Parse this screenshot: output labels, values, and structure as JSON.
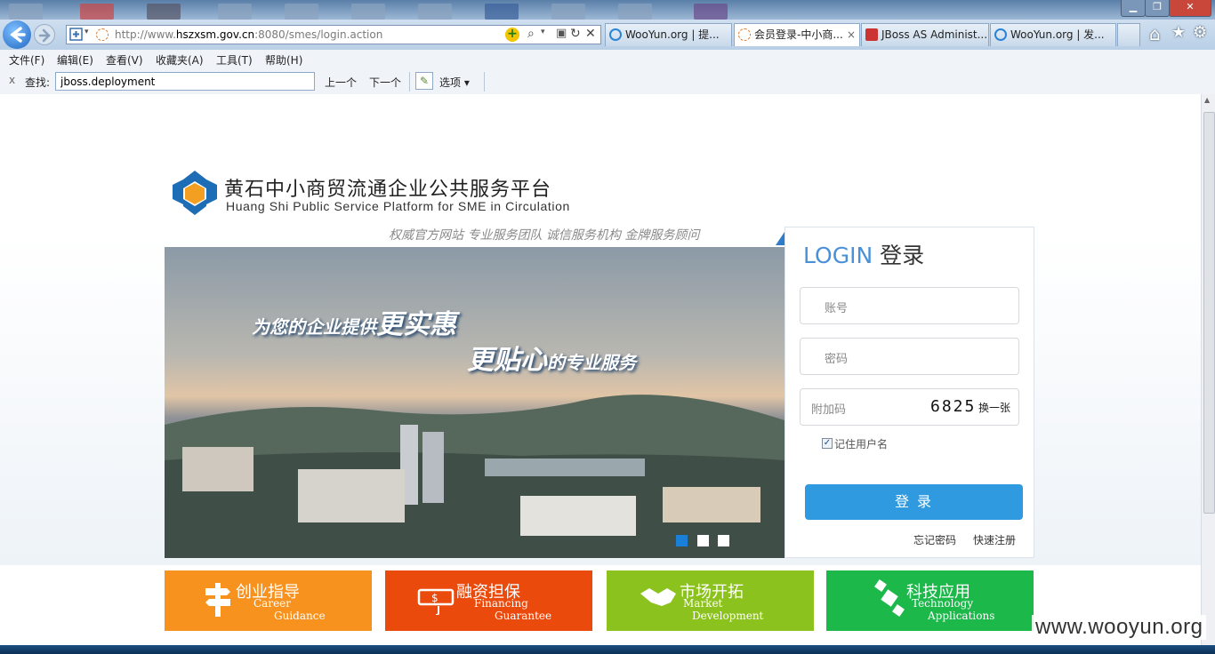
{
  "browser": {
    "address_url_prefix": "http://www.",
    "address_url_host": "hszxsm.gov.cn",
    "address_url_rest": ":8080/smes/login.action",
    "tabs": [
      {
        "label": "WooYun.org | 提..."
      },
      {
        "label": "会员登录-中小商..."
      },
      {
        "label": "JBoss AS Administ..."
      },
      {
        "label": "WooYun.org | 发..."
      }
    ],
    "tab_close": "×",
    "window_buttons": {
      "minimize": "▁",
      "restore": "❐",
      "close": "✕"
    },
    "toolbar_icons": {
      "home": "⌂",
      "favorites": "★",
      "tools": "⚙"
    }
  },
  "menu": [
    "文件(F)",
    "编辑(E)",
    "查看(V)",
    "收藏夹(A)",
    "工具(T)",
    "帮助(H)"
  ],
  "findbar": {
    "close": "x",
    "label": "查找:",
    "value": "jboss.deployment",
    "prev": "上一个",
    "next": "下一个",
    "options": "选项"
  },
  "site": {
    "title_cn": "黄石中小商贸流通企业公共服务平台",
    "title_en": "Huang Shi Public Service Platform for SME in Circulation",
    "slogan": "权威官方网站 专业服务团队  诚信服务机构  金牌服务顾问",
    "banner_line1_a": "为您的企业提供",
    "banner_line1_b": "更实惠",
    "banner_line2_a": "更贴心",
    "banner_line2_b": "的专业服务"
  },
  "login": {
    "title_en": "LOGIN",
    "title_cn": "登录",
    "account_placeholder": "账号",
    "password_placeholder": "密码",
    "captcha_placeholder": "附加码",
    "captcha_code": "6825",
    "captcha_refresh": "换一张",
    "remember_label": "记住用户名",
    "remember_checked": true,
    "submit": "登 录",
    "forgot": "忘记密码",
    "register": "快速注册"
  },
  "tiles": [
    {
      "cn": "创业指导",
      "en1": "Career",
      "en2": "Guidance",
      "color": "#f7921e"
    },
    {
      "cn": "融资担保",
      "en1": "Financing",
      "en2": "Guarantee",
      "color": "#ea4a0c"
    },
    {
      "cn": "市场开拓",
      "en1": "Market",
      "en2": "Development",
      "color": "#8cc21e"
    },
    {
      "cn": "科技应用",
      "en1": "Technology",
      "en2": "Applications",
      "color": "#1cb84a"
    }
  ],
  "watermark": "www.wooyun.org",
  "colors": {
    "accent": "#4a90d8",
    "login_button": "#2f9ae0",
    "carousel_active": "#1a7fd6"
  }
}
